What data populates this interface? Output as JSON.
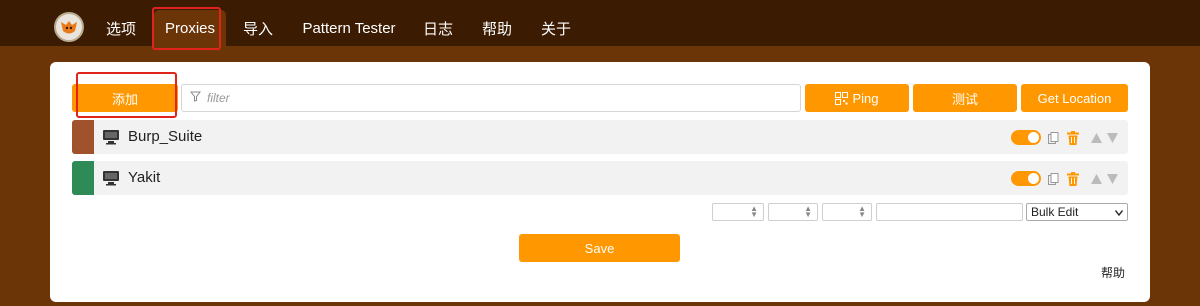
{
  "nav": {
    "tabs": [
      {
        "label": "选项"
      },
      {
        "label": "Proxies"
      },
      {
        "label": "导入"
      },
      {
        "label": "Pattern Tester"
      },
      {
        "label": "日志"
      },
      {
        "label": "帮助"
      },
      {
        "label": "关于"
      }
    ],
    "active": "Proxies"
  },
  "toolbar": {
    "add_label": "添加",
    "filter_placeholder": "filter",
    "ping_label": "Ping",
    "test_label": "测试",
    "location_label": "Get Location"
  },
  "proxies": [
    {
      "title": "Burp_Suite",
      "color": "#a0522d",
      "enabled": true
    },
    {
      "title": "Yakit",
      "color": "#2e8b57",
      "enabled": true
    }
  ],
  "bulk": {
    "select_value": "Bulk Edit"
  },
  "footer": {
    "save_label": "Save",
    "help_label": "帮助"
  },
  "colors": {
    "accent": "#ff9800",
    "nav_bg": "#3b1b02",
    "page_bg": "#6b3508",
    "highlight": "#e0241c"
  }
}
